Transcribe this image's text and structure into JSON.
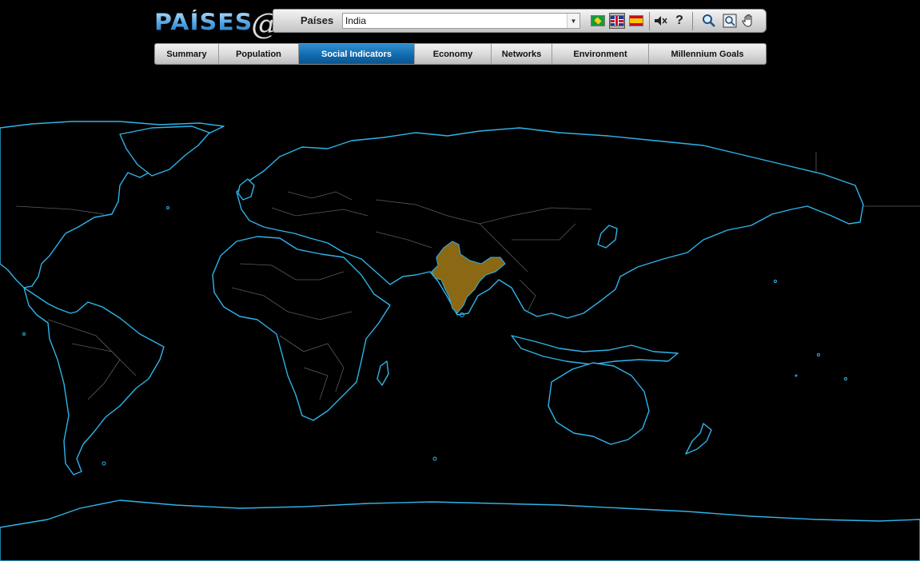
{
  "app": {
    "logo_text": "PAÍSES",
    "logo_mark": "@"
  },
  "toolbar": {
    "countries_label": "Países",
    "selected_country": "India",
    "languages": [
      {
        "name": "brazil-flag-icon"
      },
      {
        "name": "uk-flag-icon"
      },
      {
        "name": "spain-flag-icon"
      }
    ],
    "help_label": "?"
  },
  "tabs": [
    {
      "label": "Summary",
      "active": false
    },
    {
      "label": "Population",
      "active": false
    },
    {
      "label": "Social Indicators",
      "active": true
    },
    {
      "label": "Economy",
      "active": false
    },
    {
      "label": "Networks",
      "active": false
    },
    {
      "label": "Environment",
      "active": false
    },
    {
      "label": "Millennium Goals",
      "active": false
    }
  ],
  "map": {
    "highlighted_country": "India",
    "highlight_color": "#8b6914",
    "coastline_color": "#2fb4ea",
    "border_color": "#5b5b5b",
    "background_color": "#000000"
  }
}
